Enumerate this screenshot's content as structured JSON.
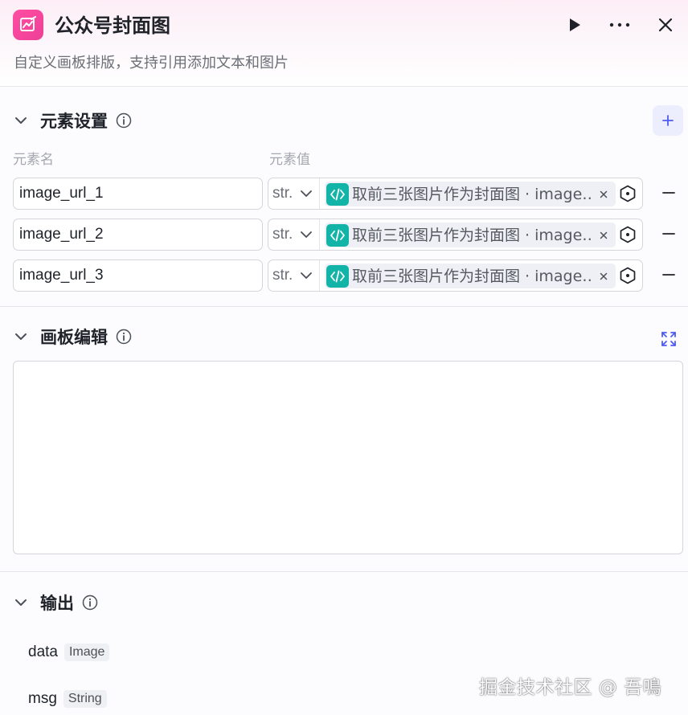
{
  "node": {
    "title": "公众号封面图",
    "description": "自定义画板排版，支持引用添加文本和图片",
    "icon": "canvas-image-icon",
    "accent_color": "#ee3f97"
  },
  "element_settings": {
    "title": "元素设置",
    "col_name": "元素名",
    "col_value": "元素值",
    "rows": [
      {
        "name": "image_url_1",
        "type": "str.",
        "ref": "取前三张图片作为封面图 · image…"
      },
      {
        "name": "image_url_2",
        "type": "str.",
        "ref": "取前三张图片作为封面图 · image…"
      },
      {
        "name": "image_url_3",
        "type": "str.",
        "ref": "取前三张图片作为封面图 · image…"
      }
    ]
  },
  "canvas_edit": {
    "title": "画板编辑"
  },
  "output": {
    "title": "输出",
    "items": [
      {
        "name": "data",
        "type": "Image"
      },
      {
        "name": "msg",
        "type": "String"
      }
    ]
  },
  "watermark": "掘金技术社区 @ 吾鳴"
}
